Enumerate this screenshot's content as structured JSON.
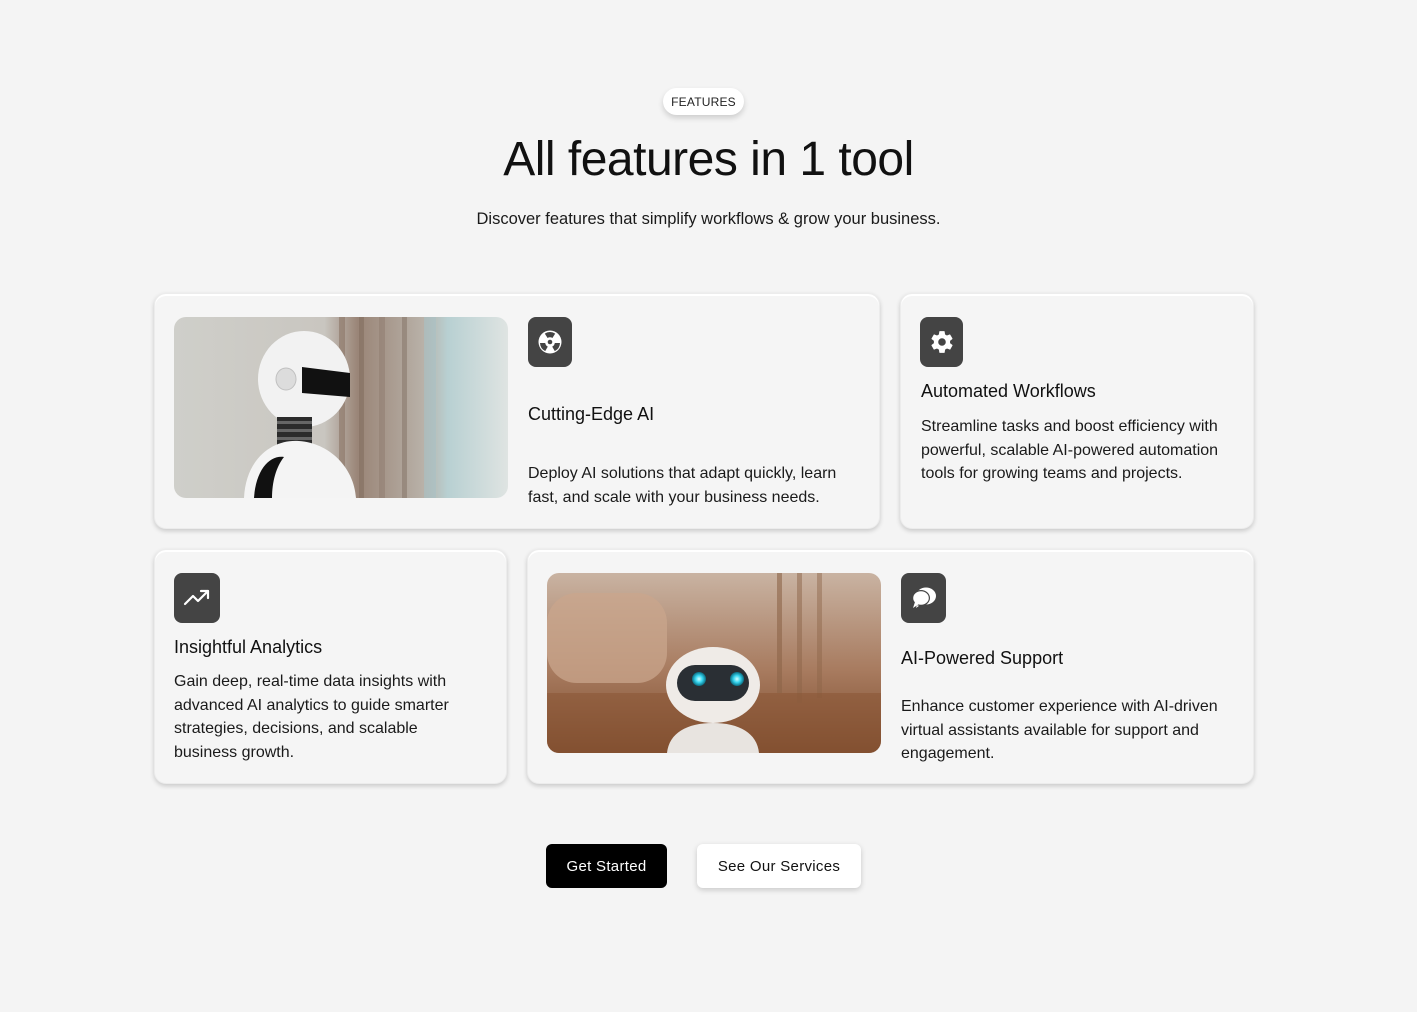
{
  "header": {
    "badge": "FEATURES",
    "title": "All features in 1 tool",
    "subtitle": "Discover features that simplify workflows & grow your business."
  },
  "features": [
    {
      "icon": "radiation-icon",
      "title": "Cutting-Edge AI",
      "description": "Deploy AI solutions that adapt quickly, learn fast, and scale with your business needs."
    },
    {
      "icon": "gear-icon",
      "title": "Automated Workflows",
      "description": "Streamline tasks and boost efficiency with powerful, scalable AI-powered automation tools for growing teams and projects."
    },
    {
      "icon": "trending-up-icon",
      "title": "Insightful Analytics",
      "description": "Gain deep, real-time data insights with advanced AI analytics to guide smarter strategies, decisions, and scalable business growth."
    },
    {
      "icon": "chat-bubbles-icon",
      "title": "AI-Powered Support",
      "description": "Enhance customer experience with AI-driven virtual assistants available for support and engagement."
    }
  ],
  "actions": {
    "primary_label": "Get Started",
    "secondary_label": "See Our Services"
  },
  "colors": {
    "background": "#f4f4f4",
    "icon_tile": "#444444",
    "primary_button": "#000000"
  }
}
